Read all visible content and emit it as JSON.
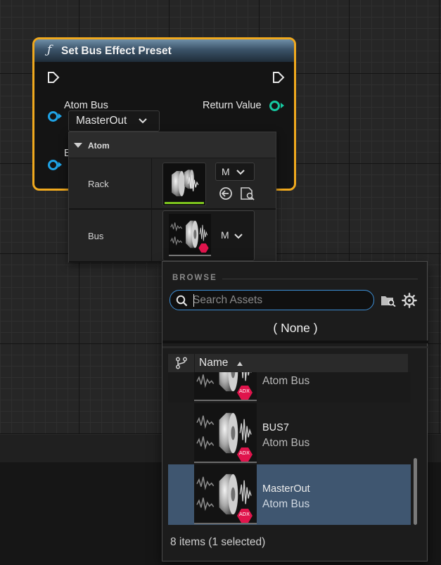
{
  "node": {
    "title": "Set Bus Effect Preset",
    "function_glyph": "ƒ",
    "pins": {
      "atom_bus_label": "Atom Bus",
      "return_value_label": "Return Value",
      "second_input_partial": "E"
    },
    "atom_bus_value": "MasterOut"
  },
  "details": {
    "section_label": "Atom",
    "rows": [
      {
        "name": "Rack",
        "combo_value": "M"
      },
      {
        "name": "Bus",
        "combo_value": "M"
      }
    ]
  },
  "picker": {
    "browse_label": "BROWSE",
    "search_placeholder": "Search Assets",
    "none_label": "( None )",
    "column_name": "Name",
    "items": [
      {
        "name": "",
        "type": "Atom Bus",
        "selected": false
      },
      {
        "name": "BUS7",
        "type": "Atom Bus",
        "selected": false
      },
      {
        "name": "MasterOut",
        "type": "Atom Bus",
        "selected": true
      }
    ],
    "badge_label": "ADX",
    "status": "8 items (1 selected)"
  },
  "colors": {
    "node_border": "#f0a91e",
    "pin_blue": "#1fa3e6",
    "pin_teal": "#16c8a0",
    "selection": "#3f5670",
    "badge": "#e0144c",
    "focus_border": "#3d8fd6"
  }
}
